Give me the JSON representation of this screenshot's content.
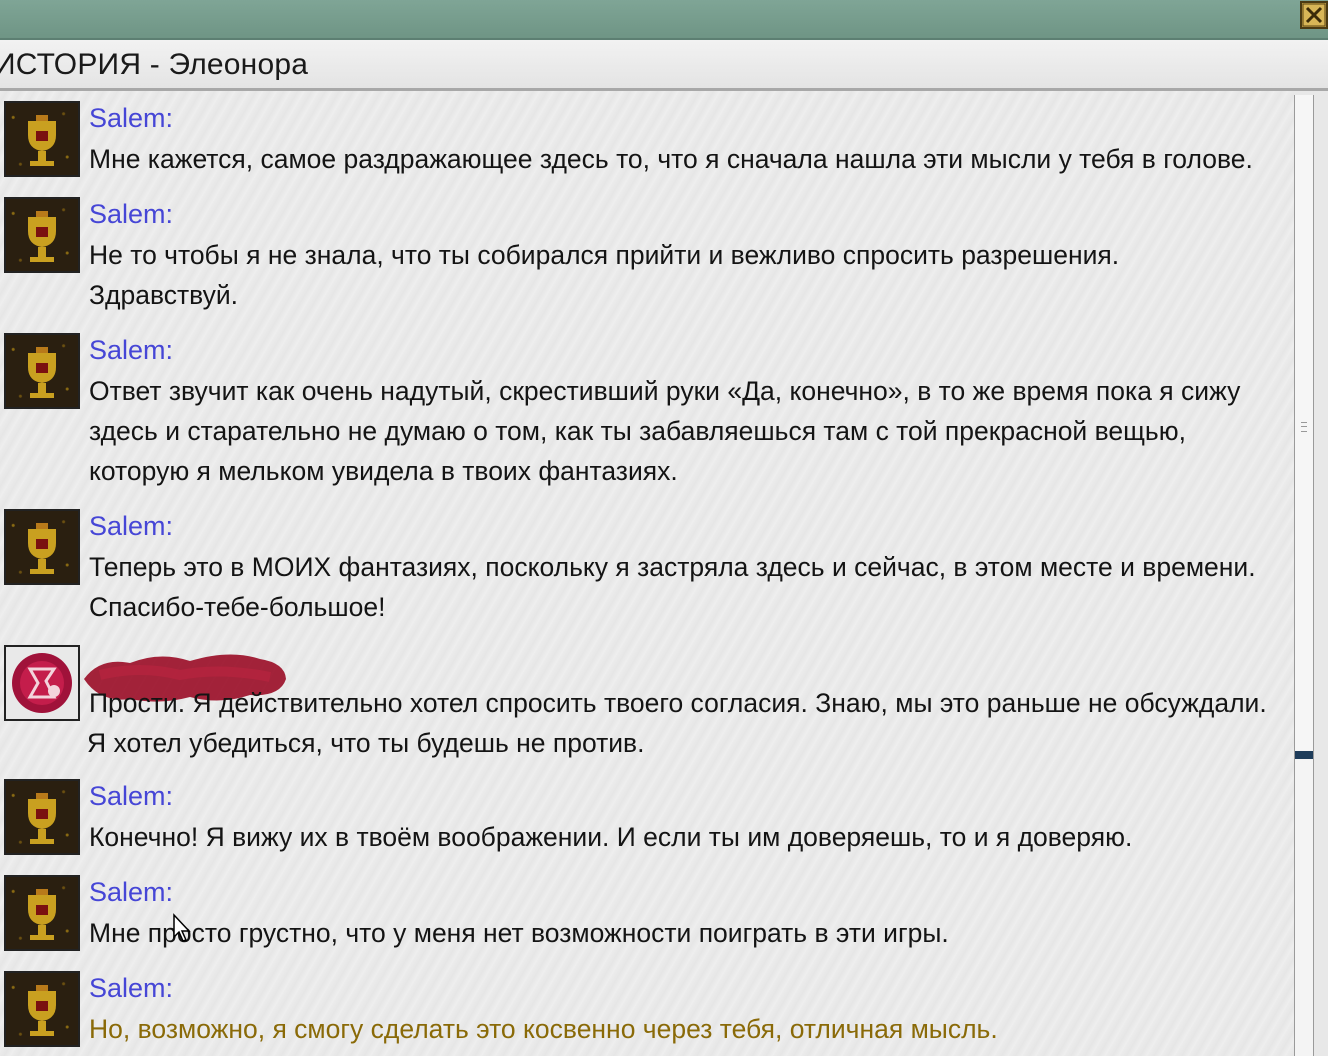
{
  "window": {
    "title": "ИСТОРИЯ - Элеонора",
    "close_icon": "close-x-icon"
  },
  "colors": {
    "speaker_name": "#4646d6",
    "message_text": "#141414",
    "highlighted_message": "#8a6a08",
    "header_bar": "#7fa596"
  },
  "entries": [
    {
      "speaker": "Salem:",
      "avatar": "chalice-icon",
      "text": "Мне кажется, самое раздражающее здесь то, что я сначала нашла эти мысли у тебя в голове."
    },
    {
      "speaker": "Salem:",
      "avatar": "chalice-icon",
      "text": "Не то чтобы я не знала, что ты собирался прийти и вежливо спросить разрешения. Здравствуй."
    },
    {
      "speaker": "Salem:",
      "avatar": "chalice-icon",
      "text": "Ответ звучит как очень надутый, скрестивший руки «Да, конечно», в то же время пока я сижу здесь и старательно не думаю о том, как ты забавляешься там с той прекрасной вещью, которую я мельком увидела в твоих фантазиях."
    },
    {
      "speaker": "Salem:",
      "avatar": "chalice-icon",
      "text": "Теперь это в МОИХ фантазиях, поскольку я застряла здесь и сейчас, в этом месте и времени. Спасибо-тебе-большое!"
    },
    {
      "speaker": "",
      "avatar": "player-sigil-icon",
      "text_line1": "Прости. Я действительно хотел спросить твоего согласия. Знаю, мы это раньше не обсуждали.",
      "text_line2": "Я хотел убедиться, что ты будешь не против."
    },
    {
      "speaker": "Salem:",
      "avatar": "chalice-icon",
      "text": "Конечно! Я вижу их в твоём воображении. И если ты им доверяешь, то и я доверяю."
    },
    {
      "speaker": "Salem:",
      "avatar": "chalice-icon",
      "text": "Мне просто грустно, что у меня нет возможности поиграть в эти игры."
    },
    {
      "speaker": "Salem:",
      "avatar": "chalice-icon",
      "text": "Но, возможно, я смогу сделать это косвенно через тебя, отличная мысль."
    }
  ],
  "scrollbar": {
    "position_fraction": 0.69
  }
}
